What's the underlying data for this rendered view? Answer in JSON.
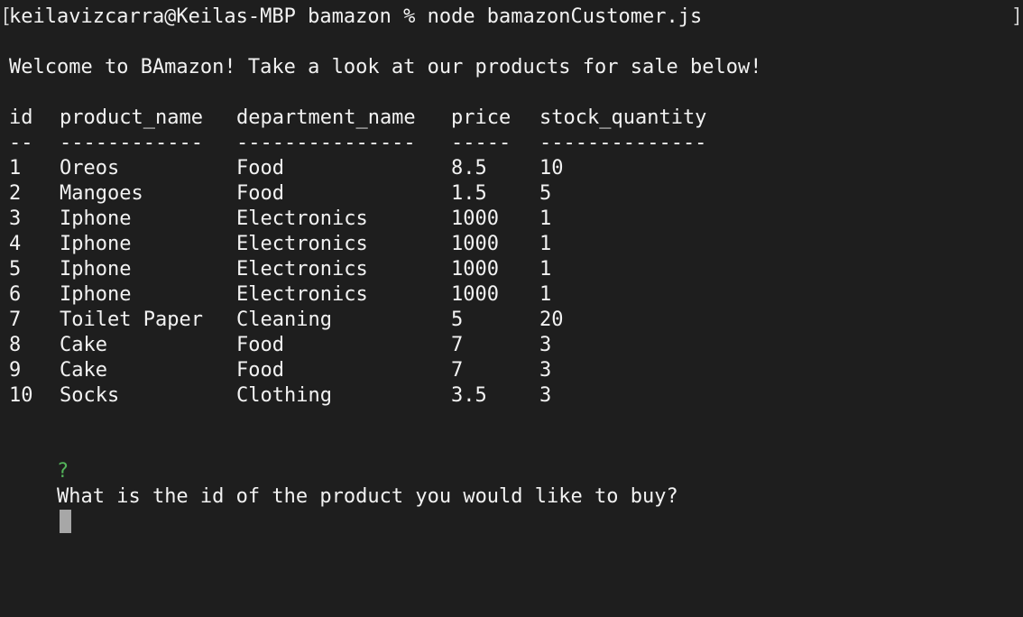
{
  "terminal": {
    "left_edge_glyph": "[",
    "right_edge_glyph": "]",
    "command_line": "keilavizcarra@Keilas-MBP bamazon % node bamazonCustomer.js",
    "welcome": "Welcome to BAmazon! Take a look at our products for sale below!",
    "table": {
      "headers": [
        "id",
        "product_name",
        "department_name",
        "price",
        "stock_quantity"
      ],
      "separators": [
        "--",
        "------------",
        "---------------",
        "-----",
        "--------------"
      ],
      "rows": [
        [
          "1",
          "Oreos",
          "Food",
          "8.5",
          "10"
        ],
        [
          "2",
          "Mangoes",
          "Food",
          "1.5",
          "5"
        ],
        [
          "3",
          "Iphone",
          "Electronics",
          "1000",
          "1"
        ],
        [
          "4",
          "Iphone",
          "Electronics",
          "1000",
          "1"
        ],
        [
          "5",
          "Iphone",
          "Electronics",
          "1000",
          "1"
        ],
        [
          "6",
          "Iphone",
          "Electronics",
          "1000",
          "1"
        ],
        [
          "7",
          "Toilet Paper",
          "Cleaning",
          "5",
          "20"
        ],
        [
          "8",
          "Cake",
          "Food",
          "7",
          "3"
        ],
        [
          "9",
          "Cake",
          "Food",
          "7",
          "3"
        ],
        [
          "10",
          "Socks",
          "Clothing",
          "3.5",
          "3"
        ]
      ]
    },
    "prompt": {
      "mark": "?",
      "question": "What is the id of the product you would like to buy?"
    },
    "colors": {
      "background": "#1e1e1e",
      "text": "#f2f2f2",
      "prompt_mark": "#53b45a",
      "cursor": "#a7a7a7"
    }
  }
}
